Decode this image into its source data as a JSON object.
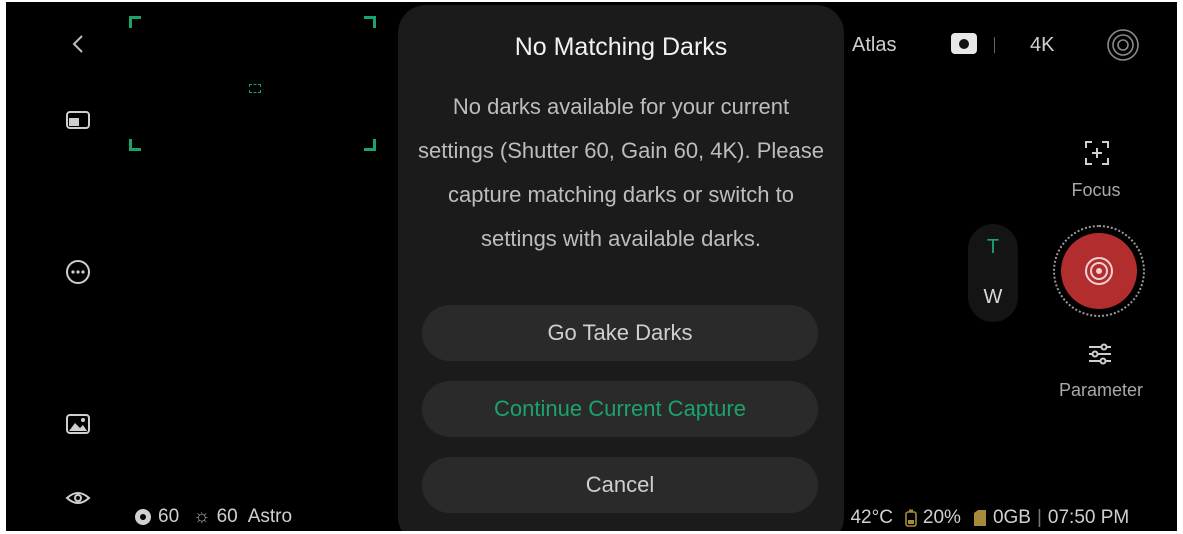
{
  "colors": {
    "accent": "#1aa36b",
    "shutter": "#b22e2e",
    "dialog_bg": "#1b1b1b",
    "button_bg": "#2a2a2a"
  },
  "top_bar": {
    "mode": "Atlas",
    "resolution": "4K"
  },
  "right_controls": {
    "focus_label": "Focus",
    "parameter_label": "Parameter",
    "zoom_tele": "T",
    "zoom_wide": "W"
  },
  "bottom_left": {
    "shutter": "60",
    "gain": "60",
    "mode": "Astro"
  },
  "bottom_right": {
    "temperature": "42°C",
    "battery": "20%",
    "storage": "0GB",
    "time": "07:50 PM"
  },
  "dialog": {
    "title": "No Matching Darks",
    "message": "No darks available for your current settings (Shutter 60, Gain 60, 4K). Please capture matching darks or switch to settings with available darks.",
    "buttons": {
      "take_darks": "Go Take Darks",
      "continue": "Continue Current Capture",
      "cancel": "Cancel"
    }
  },
  "icons": [
    "back-icon",
    "layout-icon",
    "more-icon",
    "gallery-icon",
    "eye-icon",
    "camera-icon",
    "live-icon",
    "focus-icon",
    "target-icon",
    "sliders-icon",
    "shutter-icon",
    "gain-icon",
    "thermometer-icon",
    "battery-icon",
    "sd-card-icon"
  ]
}
